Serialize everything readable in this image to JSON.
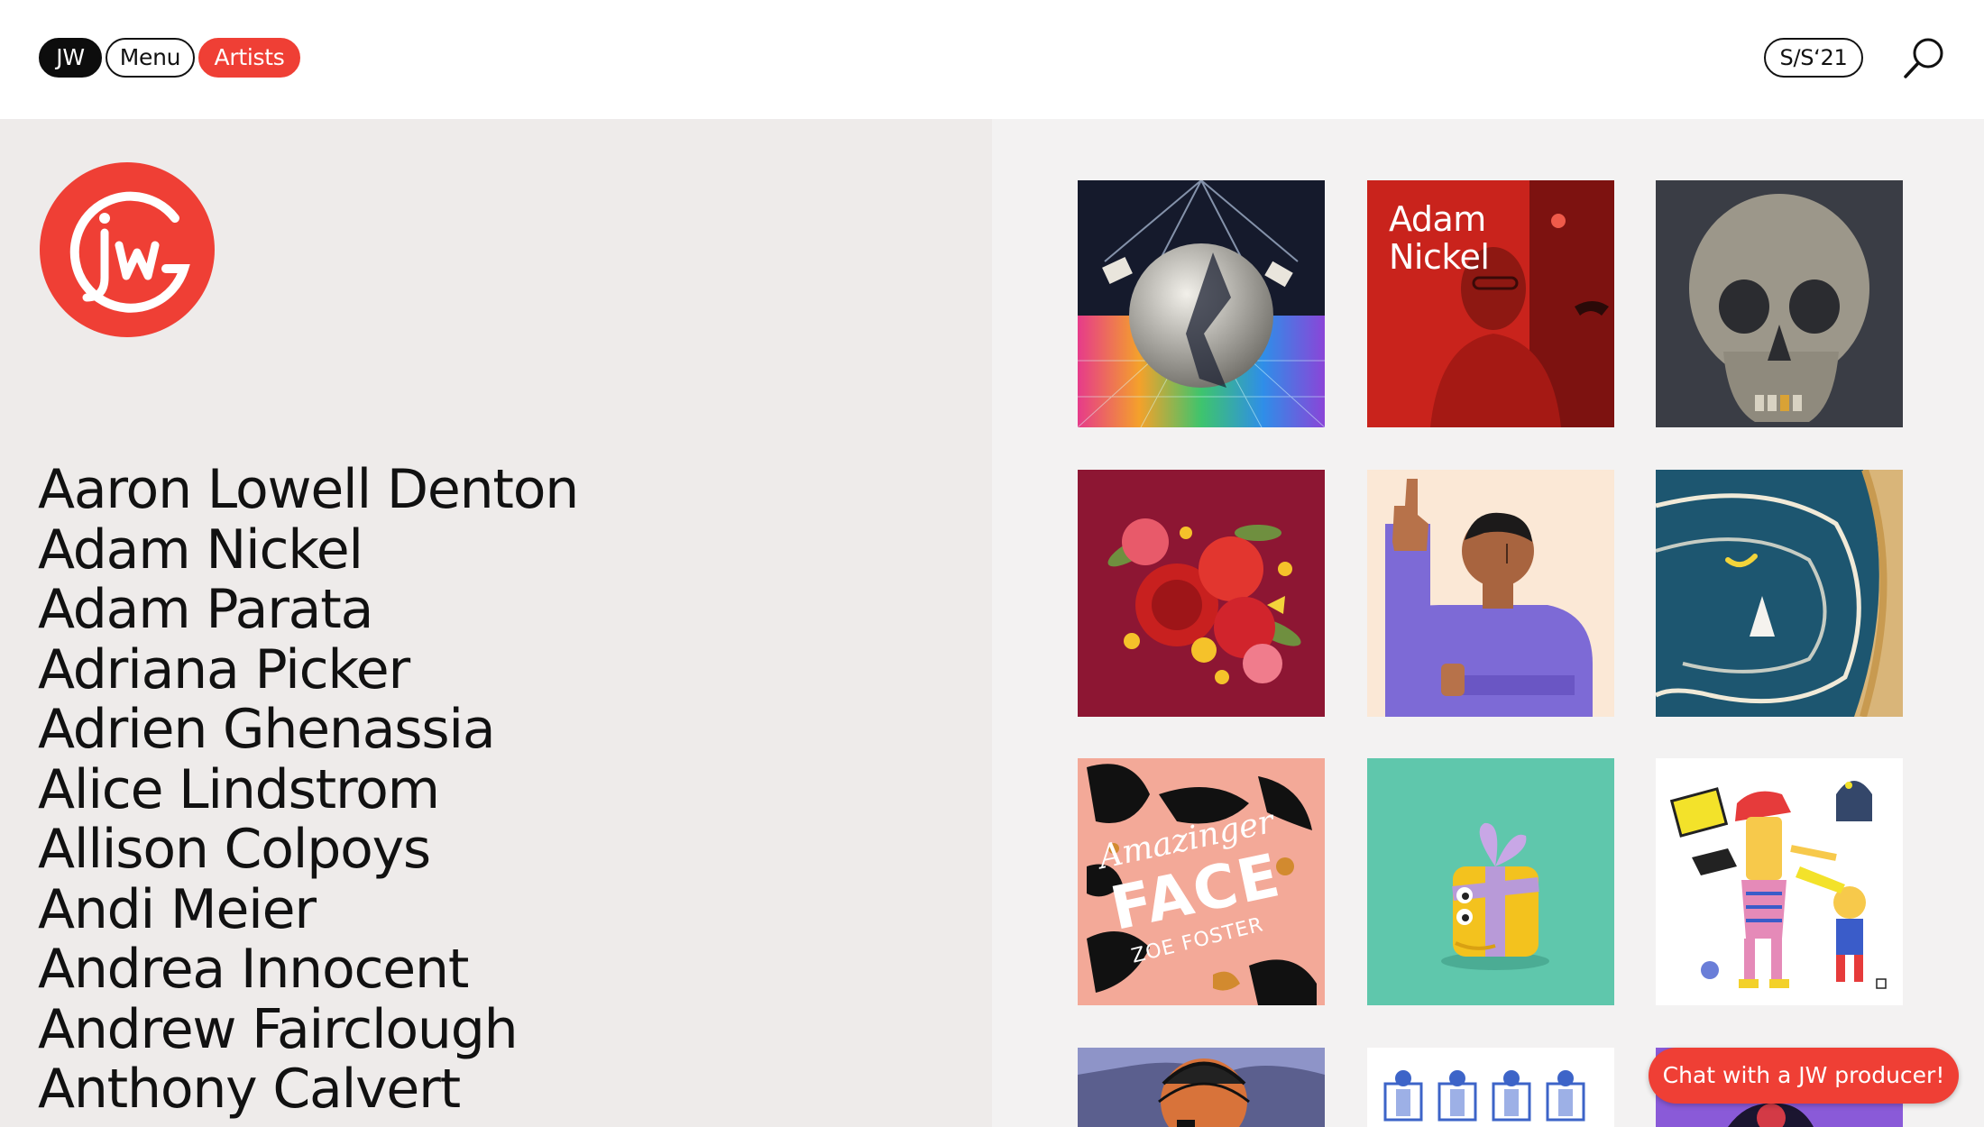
{
  "header": {
    "home_label": "JW",
    "menu_label": "Menu",
    "artists_label": "Artists",
    "season_label": "S/S‘21"
  },
  "colors": {
    "accent": "#ef3f35",
    "left_bg": "#eeebea",
    "right_bg": "#f3f2f2"
  },
  "artists": [
    "Aaron Lowell Denton",
    "Adam Nickel",
    "Adam Parata",
    "Adriana Picker",
    "Adrien Ghenassia",
    "Alice Lindstrom",
    "Allison Colpoys",
    "Andi Meier",
    "Andrea Innocent",
    "Andrew Fairclough",
    "Anthony Calvert"
  ],
  "thumbnails": {
    "adam_nickel_line1": "Adam",
    "adam_nickel_line2": "Nickel",
    "amazinger_title": "Amazinger",
    "face_title": "FACE",
    "zoe_foster": "ZOE FOSTER"
  },
  "chat": {
    "label": "Chat with a JW producer!"
  },
  "icons": [
    "search-icon",
    "jw-logo"
  ]
}
